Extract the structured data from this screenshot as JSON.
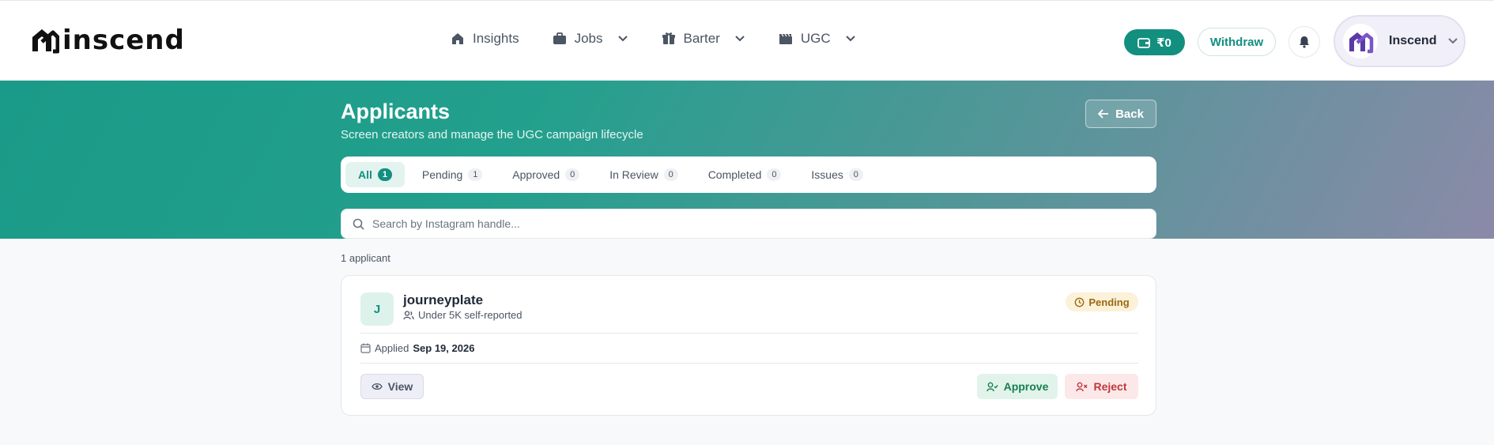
{
  "brand": {
    "name": "inscend"
  },
  "nav": {
    "items": [
      {
        "label": "Insights",
        "icon": "home-icon",
        "has_dropdown": false
      },
      {
        "label": "Jobs",
        "icon": "briefcase-icon",
        "has_dropdown": true
      },
      {
        "label": "Barter",
        "icon": "gift-icon",
        "has_dropdown": true
      },
      {
        "label": "UGC",
        "icon": "clapperboard-icon",
        "has_dropdown": true
      }
    ],
    "wallet_balance": "₹0",
    "withdraw_label": "Withdraw",
    "profile_name": "Inscend"
  },
  "header": {
    "title": "Applicants",
    "subtitle": "Screen creators and manage the UGC campaign lifecycle",
    "back_label": "Back"
  },
  "tabs": [
    {
      "label": "All",
      "count": "1",
      "active": true
    },
    {
      "label": "Pending",
      "count": "1",
      "active": false
    },
    {
      "label": "Approved",
      "count": "0",
      "active": false
    },
    {
      "label": "In Review",
      "count": "0",
      "active": false
    },
    {
      "label": "Completed",
      "count": "0",
      "active": false
    },
    {
      "label": "Issues",
      "count": "0",
      "active": false
    }
  ],
  "search": {
    "placeholder": "Search by Instagram handle...",
    "value": ""
  },
  "results": {
    "count_text": "1 applicant"
  },
  "applicant": {
    "initial": "J",
    "handle": "journeyplate",
    "followers": "Under 5K self-reported",
    "status": "Pending",
    "applied_label": "Applied",
    "applied_date": "Sep 19, 2026",
    "view_label": "View",
    "approve_label": "Approve",
    "reject_label": "Reject"
  },
  "colors": {
    "accent": "#128f7f",
    "pending": "#9a6a12",
    "approve": "#17804f",
    "reject": "#c0373d"
  }
}
